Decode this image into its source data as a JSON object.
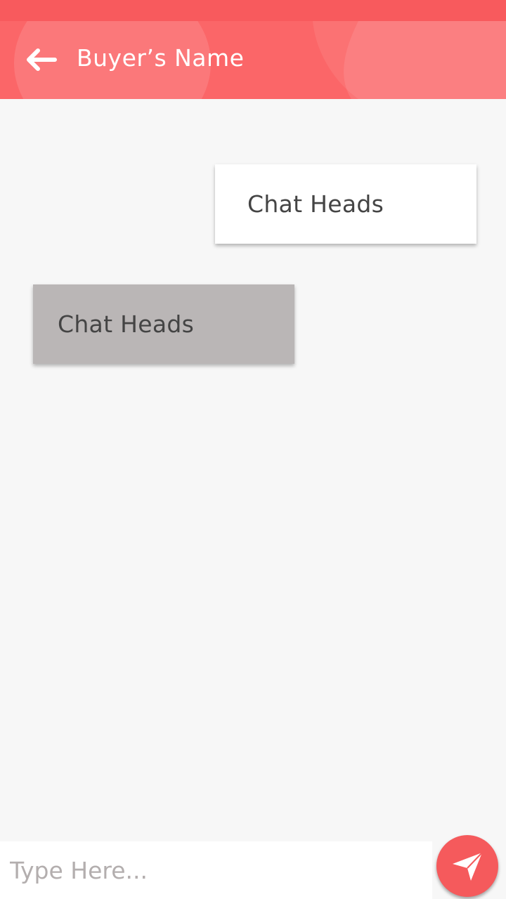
{
  "header": {
    "back_icon": "arrow-left-icon",
    "title": "Buyer’s Name"
  },
  "messages": [
    {
      "direction": "sent",
      "text": "Chat Heads"
    },
    {
      "direction": "received",
      "text": "Chat Heads"
    }
  ],
  "composer": {
    "placeholder": "Type Here...",
    "value": "",
    "send_icon": "paper-plane-icon"
  },
  "colors": {
    "status_bar": "#f85a5d",
    "app_bar": "#fb6668",
    "background": "#f7f7f7",
    "sent_bubble": "#ffffff",
    "received_bubble": "#bab6b6",
    "message_text": "#444444",
    "send_button": "#f55a5c",
    "placeholder": "#b3aeae"
  }
}
